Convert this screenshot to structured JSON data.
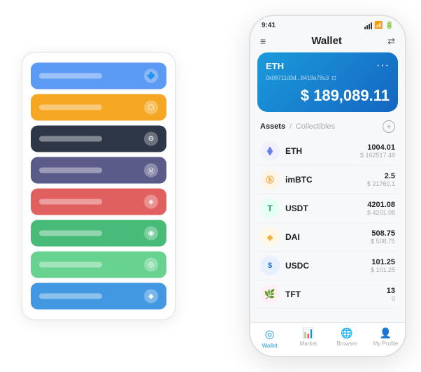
{
  "scene": {
    "bg": "#ffffff"
  },
  "cardStack": {
    "cards": [
      {
        "color": "card-blue",
        "label": "",
        "icon": "🔷"
      },
      {
        "color": "card-orange",
        "label": "",
        "icon": "⬡"
      },
      {
        "color": "card-dark",
        "label": "",
        "icon": "⚙"
      },
      {
        "color": "card-purple",
        "label": "",
        "icon": "Ⓜ"
      },
      {
        "color": "card-red",
        "label": "",
        "icon": "◈"
      },
      {
        "color": "card-green",
        "label": "",
        "icon": "◉"
      },
      {
        "color": "card-light-green",
        "label": "",
        "icon": "◎"
      },
      {
        "color": "card-blue2",
        "label": "",
        "icon": "◆"
      }
    ]
  },
  "phone": {
    "statusBar": {
      "time": "9:41",
      "wifi": true,
      "battery": true
    },
    "header": {
      "menuIcon": "≡",
      "title": "Wallet",
      "scanIcon": "⇄"
    },
    "ethCard": {
      "label": "ETH",
      "dots": "···",
      "address": "0x08711d3d...8418a78u3",
      "copyIcon": "⊡",
      "balance": "$ 189,089.11"
    },
    "assetsSection": {
      "activeTab": "Assets",
      "separator": "/",
      "inactiveTab": "Collectibles",
      "addIcon": "+"
    },
    "assets": [
      {
        "name": "ETH",
        "icon": "♦",
        "iconClass": "icon-eth",
        "amount": "1004.01",
        "usd": "$ 162517.48"
      },
      {
        "name": "imBTC",
        "icon": "Ⓑ",
        "iconClass": "icon-imbtc",
        "amount": "2.5",
        "usd": "$ 21760.1"
      },
      {
        "name": "USDT",
        "icon": "T",
        "iconClass": "icon-usdt",
        "amount": "4201.08",
        "usd": "$ 4201.08"
      },
      {
        "name": "DAI",
        "icon": "◈",
        "iconClass": "icon-dai",
        "amount": "508.75",
        "usd": "$ 508.75"
      },
      {
        "name": "USDC",
        "icon": "$",
        "iconClass": "icon-usdc",
        "amount": "101.25",
        "usd": "$ 101.25"
      },
      {
        "name": "TFT",
        "icon": "🌿",
        "iconClass": "icon-tft",
        "amount": "13",
        "usd": "0"
      }
    ],
    "bottomNav": [
      {
        "icon": "◎",
        "label": "Wallet",
        "active": true
      },
      {
        "icon": "📈",
        "label": "Market",
        "active": false
      },
      {
        "icon": "🌐",
        "label": "Browser",
        "active": false
      },
      {
        "icon": "👤",
        "label": "My Profile",
        "active": false
      }
    ]
  }
}
